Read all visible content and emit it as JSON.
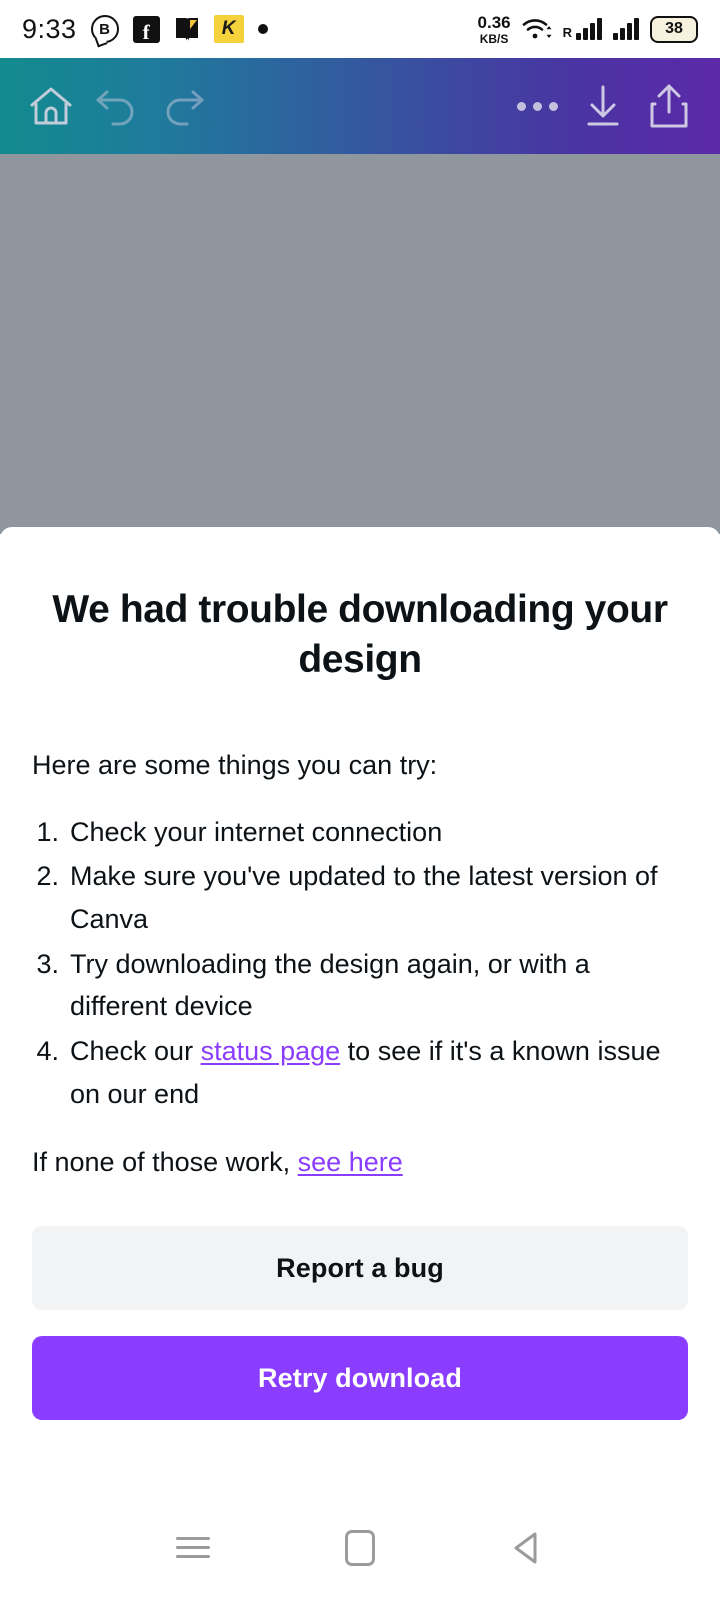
{
  "status_bar": {
    "time": "9:33",
    "icons": [
      "messenger-b-icon",
      "facebook-icon",
      "book-icon",
      "k-badge-icon",
      "dot-icon"
    ],
    "k_badge_letter": "K",
    "b_badge_letter": "B",
    "fb_letter": "f",
    "network_speed_value": "0.36",
    "network_speed_unit": "KB/S",
    "roaming_label": "R",
    "battery_level": "38"
  },
  "toolbar": {
    "home_label": "Home",
    "undo_label": "Undo",
    "redo_label": "Redo",
    "more_label": "More options",
    "download_label": "Download",
    "share_label": "Share",
    "gradient_start": "#128b8e",
    "gradient_end": "#5c29a8"
  },
  "sheet": {
    "title": "We had trouble downloading your design",
    "intro": "Here are some things you can try:",
    "steps": [
      {
        "num": "1.",
        "prefix": "Check your internet connection",
        "link": "",
        "suffix": ""
      },
      {
        "num": "2.",
        "prefix": "Make sure you've updated to the latest version of Canva",
        "link": "",
        "suffix": ""
      },
      {
        "num": "3.",
        "prefix": "Try downloading the design again, or with a different device",
        "link": "",
        "suffix": ""
      },
      {
        "num": "4.",
        "prefix": "Check our ",
        "link": "status page",
        "suffix": " to see if it's a known issue on our end"
      }
    ],
    "footnote_prefix": "If none of those work, ",
    "footnote_link": "see here",
    "report_bug_label": "Report a bug",
    "retry_label": "Retry download",
    "link_color": "#8b3dff",
    "primary_color": "#8b3dff",
    "secondary_color": "#f2f3f5"
  },
  "nav_bar": {
    "recents_label": "Recents",
    "home_label": "Home",
    "back_label": "Back"
  }
}
